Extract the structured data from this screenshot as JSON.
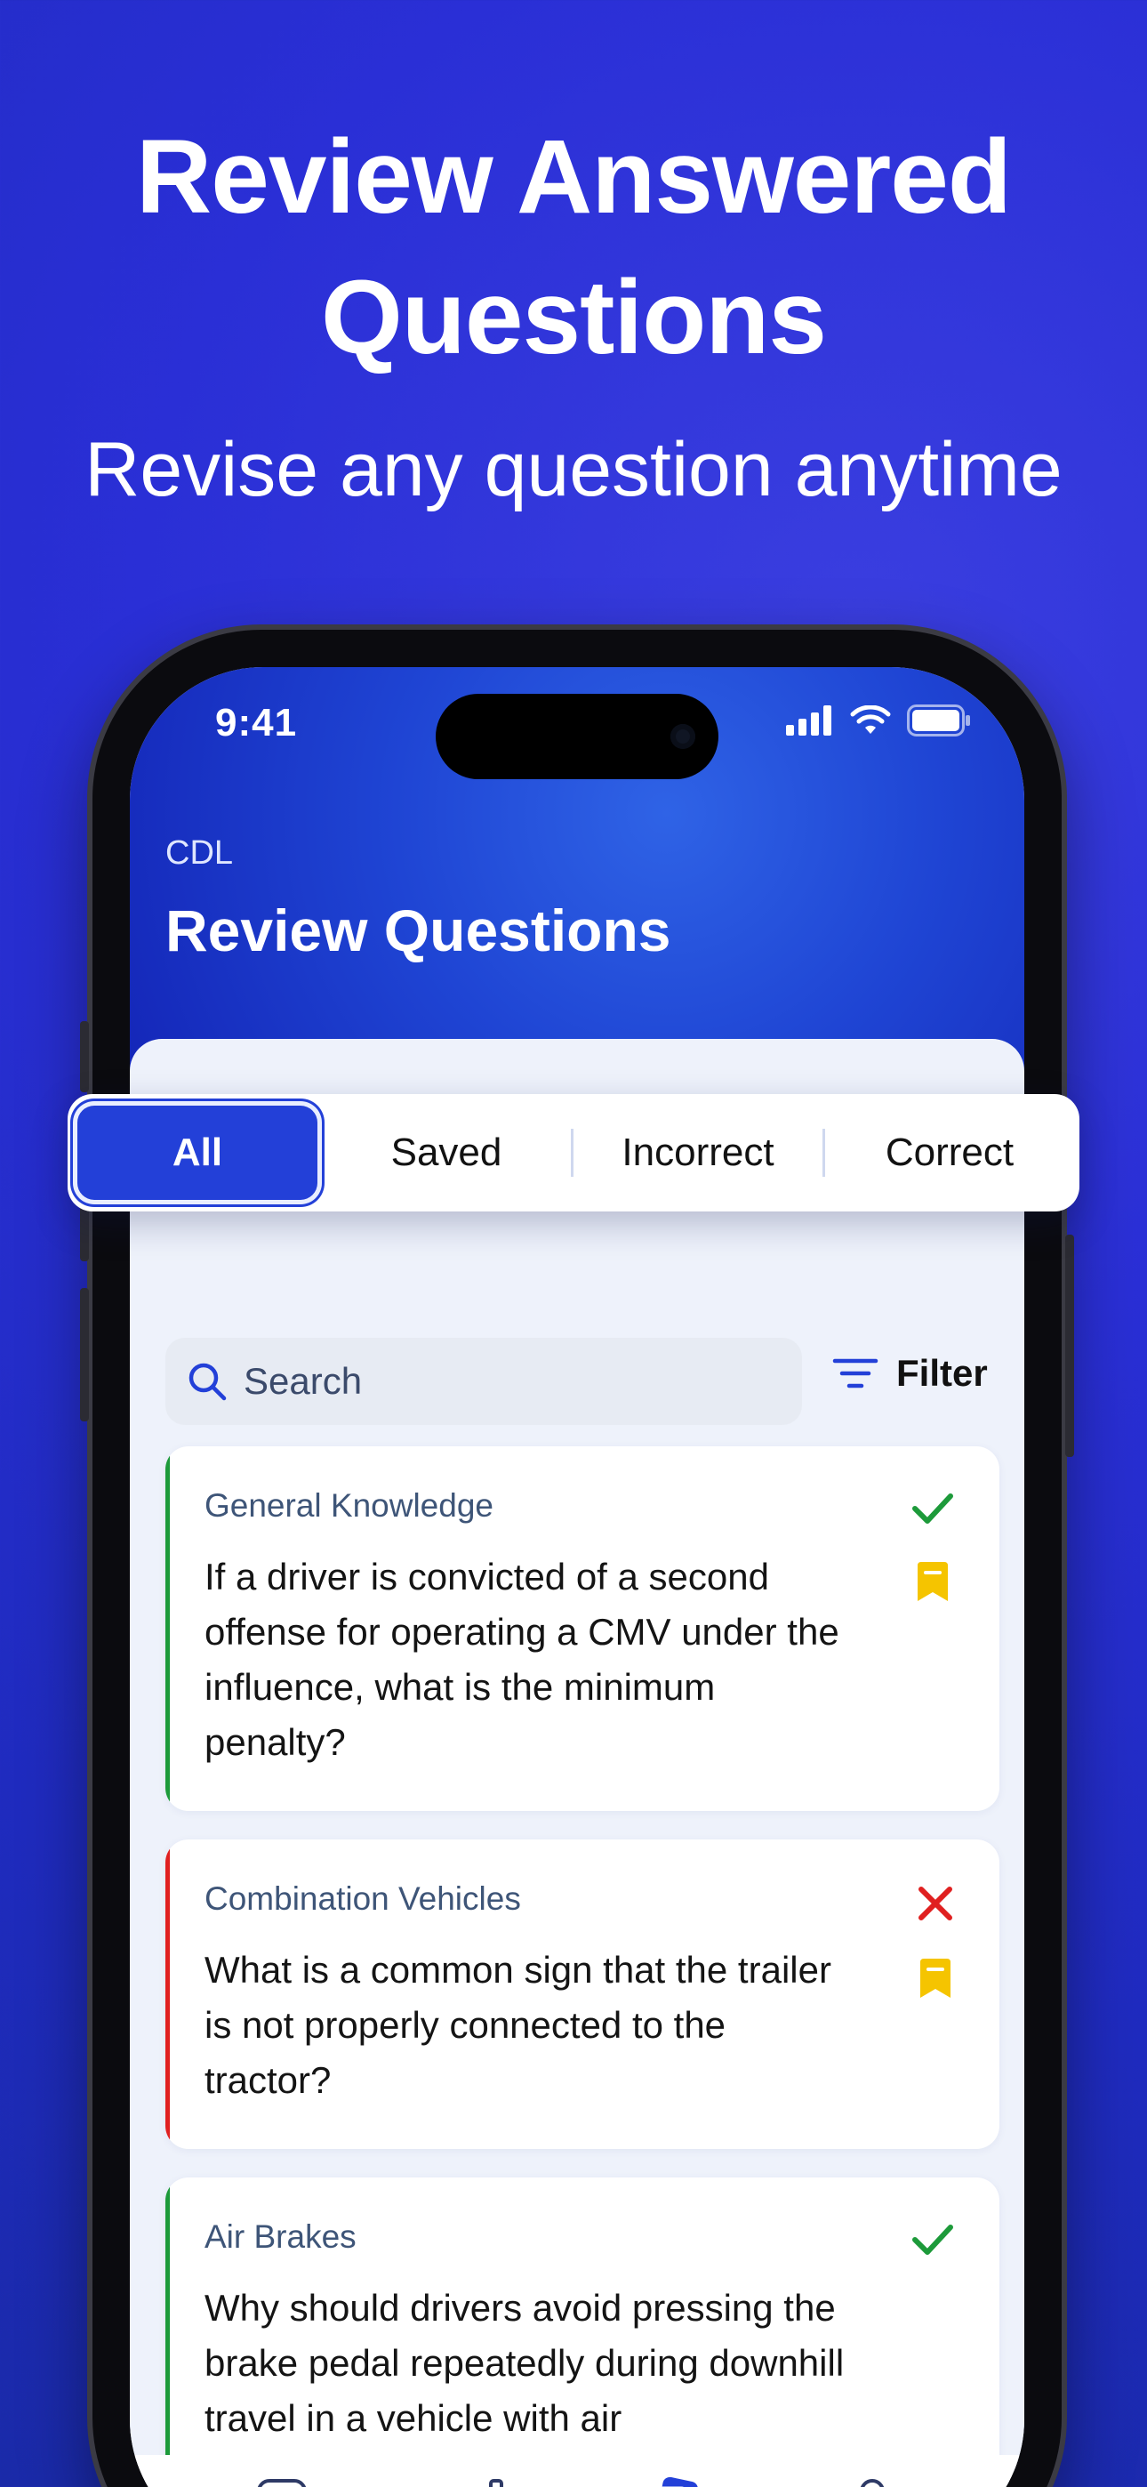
{
  "hero": {
    "title_line1": "Review Answered",
    "title_line2": "Questions",
    "subtitle": "Revise any question anytime"
  },
  "status_bar": {
    "time": "9:41"
  },
  "header": {
    "subtitle": "CDL",
    "title": "Review Questions"
  },
  "segments": [
    {
      "label": "All",
      "active": true
    },
    {
      "label": "Saved",
      "active": false
    },
    {
      "label": "Incorrect",
      "active": false
    },
    {
      "label": "Correct",
      "active": false
    }
  ],
  "search": {
    "placeholder": "Search"
  },
  "filter": {
    "label": "Filter"
  },
  "questions": [
    {
      "category": "General Knowledge",
      "question": "If a driver is convicted of a second offense for operating a CMV under the influence, what is the minimum penalty?",
      "result": "correct",
      "saved": true
    },
    {
      "category": "Combination Vehicles",
      "question": "What is a common sign that the trailer is not properly connected to the tractor?",
      "result": "incorrect",
      "saved": true
    },
    {
      "category": "Air Brakes",
      "question": "Why should drivers avoid pressing the brake pedal repeatedly during downhill travel in a vehicle with air",
      "result": "correct",
      "saved": false
    }
  ],
  "colors": {
    "accent": "#2340d8",
    "correct": "#1d9a3a",
    "incorrect": "#e02020",
    "bookmark": "#f5c400"
  },
  "tabs": [
    {
      "icon": "checklist-icon",
      "active": false
    },
    {
      "icon": "stats-icon",
      "active": false
    },
    {
      "icon": "review-icon",
      "active": true
    },
    {
      "icon": "unlock-icon",
      "active": false
    }
  ]
}
